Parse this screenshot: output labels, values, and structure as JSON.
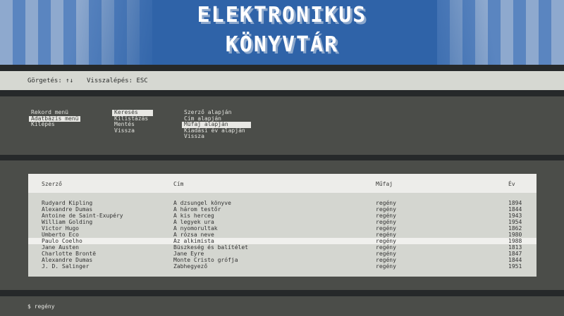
{
  "header": {
    "title_line1": "ELEKTRONIKUS",
    "title_line2": "KÖNYVTÁR",
    "colors": {
      "banner": "#2f63a8",
      "step_light": "#8ea9ce",
      "step_mid": "#5a85c0"
    }
  },
  "hints": {
    "scroll_label": "Görgetés: ↑↓",
    "back_label": "Visszalépés: ESC"
  },
  "menu": {
    "main": [
      {
        "label": "Rekord menü",
        "selected": false
      },
      {
        "label": "Adatbázis menü",
        "selected": true
      },
      {
        "label": "Kilépés",
        "selected": false
      }
    ],
    "database": [
      {
        "label": "Keresés",
        "selected": true
      },
      {
        "label": "Kilistázás",
        "selected": false
      },
      {
        "label": "Mentés",
        "selected": false
      },
      {
        "label": "Vissza",
        "selected": false
      }
    ],
    "search": [
      {
        "label": "Szerző alapján",
        "selected": false
      },
      {
        "label": "Cím alapján",
        "selected": false
      },
      {
        "label": "Műfaj alapján",
        "selected": true
      },
      {
        "label": "Kiadási év alapján",
        "selected": false
      },
      {
        "label": "Vissza",
        "selected": false
      }
    ]
  },
  "table": {
    "columns": [
      "Szerző",
      "Cím",
      "Műfaj",
      "Év"
    ],
    "rows": [
      [
        "Rudyard Kipling",
        "A dzsungel könyve",
        "regény",
        "1894"
      ],
      [
        "Alexandre Dumas",
        "A három testőr",
        "regény",
        "1844"
      ],
      [
        "Antoine de Saint-Exupéry",
        "A kis herceg",
        "regény",
        "1943"
      ],
      [
        "William Golding",
        "A legyek ura",
        "regény",
        "1954"
      ],
      [
        "Victor Hugo",
        "A nyomorultak",
        "regény",
        "1862"
      ],
      [
        "Umberto Eco",
        "A rózsa neve",
        "regény",
        "1980"
      ],
      [
        "Paulo Coelho",
        "Az alkimista",
        "regény",
        "1988"
      ],
      [
        "Jane Austen",
        "Büszkeség és balítélet",
        "regény",
        "1813"
      ],
      [
        "Charlotte Brontë",
        "Jane Eyre",
        "regény",
        "1847"
      ],
      [
        "Alexandre Dumas",
        "Monte Cristo grófja",
        "regény",
        "1844"
      ],
      [
        "J. D. Salinger",
        "Zabhegyező",
        "regény",
        "1951"
      ]
    ],
    "selected_row": 6
  },
  "prompt": {
    "text": "$ regény"
  }
}
